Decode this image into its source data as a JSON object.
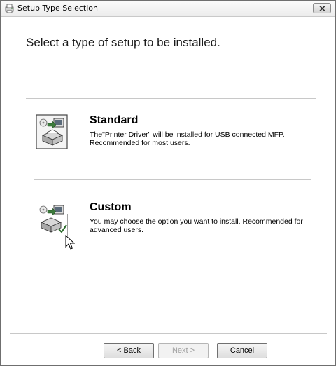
{
  "window": {
    "title": "Setup Type Selection"
  },
  "heading": "Select a type of setup to be installed.",
  "options": [
    {
      "title": "Standard",
      "description": "The\"Printer Driver\" will be installed for USB connected MFP. Recommended for most users.",
      "icon": "printer-install-icon"
    },
    {
      "title": "Custom",
      "description": "You may choose the option you want to install. Recommended for advanced users.",
      "icon": "printer-custom-install-icon"
    }
  ],
  "buttons": {
    "back": "< Back",
    "next": "Next >",
    "cancel": "Cancel"
  }
}
